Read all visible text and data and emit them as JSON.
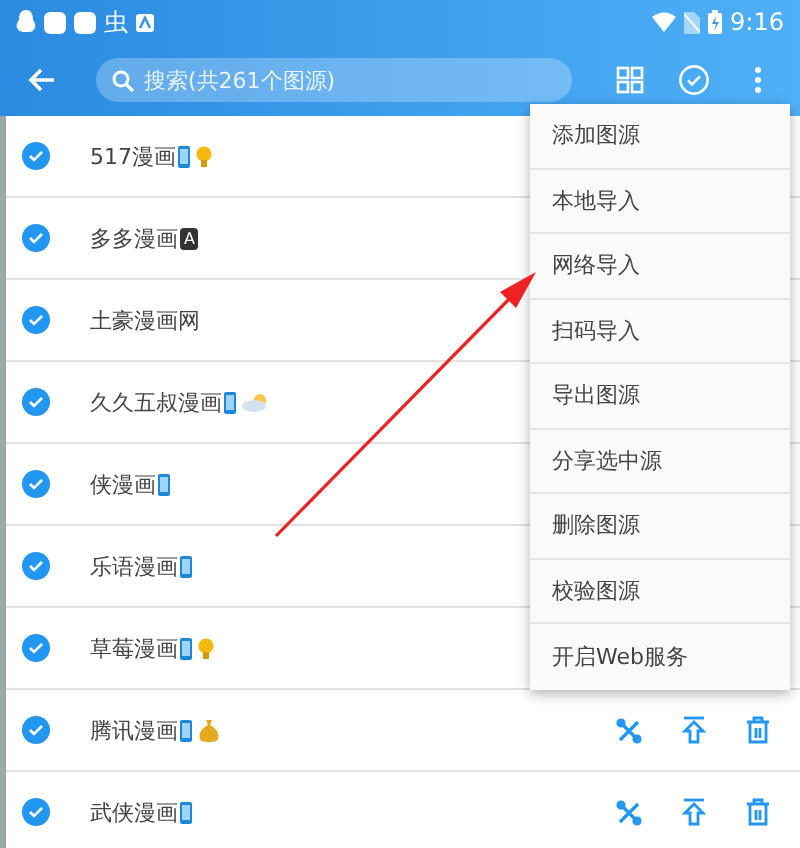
{
  "status_bar": {
    "notification_glyph": "虫",
    "time": "9:16"
  },
  "toolbar": {
    "search": {
      "placeholder": "搜索(共261个图源)"
    }
  },
  "rows": [
    {
      "name": "517漫画",
      "checked": true,
      "badges": [
        {
          "kind": "phone"
        },
        {
          "kind": "bulb"
        }
      ],
      "actions": false
    },
    {
      "name": "多多漫画",
      "checked": true,
      "badges": [
        {
          "kind": "tag",
          "text": "A"
        }
      ],
      "actions": false
    },
    {
      "name": "土豪漫画网",
      "checked": true,
      "badges": [],
      "actions": false
    },
    {
      "name": "久久五叔漫画",
      "checked": true,
      "badges": [
        {
          "kind": "phone"
        },
        {
          "kind": "cloud"
        }
      ],
      "actions": false
    },
    {
      "name": "侠漫画",
      "checked": true,
      "badges": [
        {
          "kind": "phone"
        }
      ],
      "actions": false
    },
    {
      "name": "乐语漫画",
      "checked": true,
      "badges": [
        {
          "kind": "phone"
        }
      ],
      "actions": false
    },
    {
      "name": "草莓漫画",
      "checked": true,
      "badges": [
        {
          "kind": "phone"
        },
        {
          "kind": "bulb"
        }
      ],
      "actions": false
    },
    {
      "name": "腾讯漫画",
      "checked": true,
      "badges": [
        {
          "kind": "phone"
        },
        {
          "kind": "money"
        }
      ],
      "actions": true
    },
    {
      "name": "武侠漫画",
      "checked": true,
      "badges": [
        {
          "kind": "phone"
        }
      ],
      "actions": true
    }
  ],
  "menu": [
    "添加图源",
    "本地导入",
    "网络导入",
    "扫码导入",
    "导出图源",
    "分享选中源",
    "删除图源",
    "校验图源",
    "开启Web服务"
  ]
}
